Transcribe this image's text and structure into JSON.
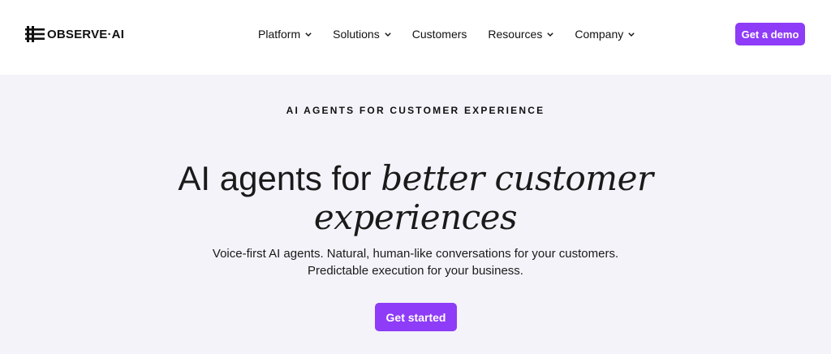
{
  "header": {
    "logo_text": "OBSERVE·AI",
    "nav": [
      {
        "label": "Platform",
        "has_dropdown": true
      },
      {
        "label": "Solutions",
        "has_dropdown": true
      },
      {
        "label": "Customers",
        "has_dropdown": false
      },
      {
        "label": "Resources",
        "has_dropdown": true
      },
      {
        "label": "Company",
        "has_dropdown": true
      }
    ],
    "cta_label": "Get a demo"
  },
  "hero": {
    "eyebrow": "AI AGENTS FOR CUSTOMER EXPERIENCE",
    "headline_plain": "AI agents for",
    "headline_serif_1": "better customer",
    "headline_serif_2": "experiences",
    "subtext_line1": "Voice-first AI agents. Natural, human-like conversations for your customers.",
    "subtext_line2": "Predictable execution for your business.",
    "cta_label": "Get started"
  },
  "colors": {
    "accent": "#8e3cf7",
    "hero_bg": "#f4f3f9",
    "header_bg": "#ffffff"
  },
  "icons": {
    "logo_mark": "observe-ai-logo-icon",
    "dropdown": "chevron-down-icon"
  }
}
